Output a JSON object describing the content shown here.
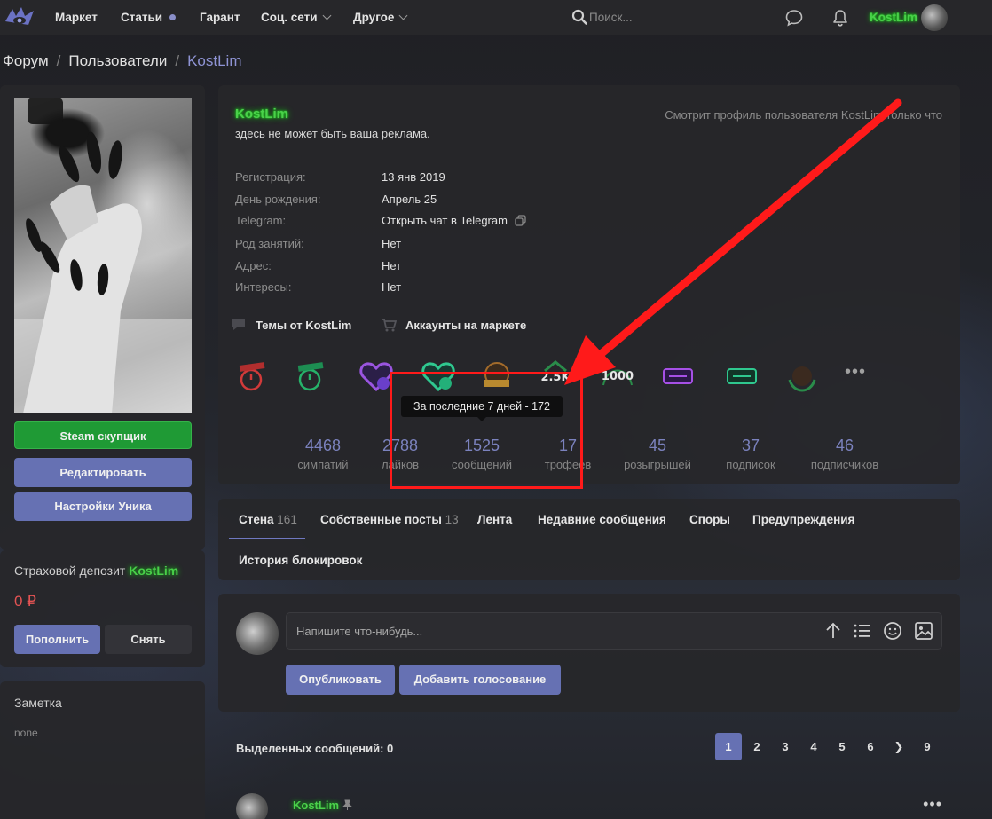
{
  "nav": {
    "items": [
      {
        "label": "Маркет"
      },
      {
        "label": "Статьи"
      },
      {
        "label": "Гарант"
      },
      {
        "label": "Соц. сети"
      },
      {
        "label": "Другое"
      }
    ],
    "search_placeholder": "Поиск...",
    "username": "KostLim"
  },
  "breadcrumb": {
    "items": [
      "Форум",
      "Пользователи",
      "KostLim"
    ]
  },
  "sidebar": {
    "buttons": {
      "steam": "Steam скупщик",
      "edit": "Редактировать",
      "settings": "Настройки Уника"
    },
    "deposit": {
      "title": "Страховой депозит",
      "name": "KostLim",
      "amount": "0 ₽",
      "topup": "Пополнить",
      "withdraw": "Снять"
    },
    "note": {
      "title": "Заметка",
      "text": "none"
    }
  },
  "profile": {
    "name": "KostLim",
    "status": "здесь не может быть ваша реклама.",
    "viewing": "Смотрит профиль пользователя KostLim только что",
    "info": [
      {
        "label": "Регистрация:",
        "value": "13 янв 2019"
      },
      {
        "label": "День рождения:",
        "value": "Апрель 25"
      },
      {
        "label": "Telegram:",
        "value": "Открыть чат в Telegram"
      },
      {
        "label": "Род занятий:",
        "value": "Нет"
      },
      {
        "label": "Адрес:",
        "value": "Нет"
      },
      {
        "label": "Интересы:",
        "value": "Нет"
      }
    ],
    "links": {
      "threads": "Темы от KostLim",
      "market": "Аккаунты на маркете"
    },
    "trophy_icons": [
      "stopwatch-red-icon",
      "stopwatch-green-icon",
      "heart-2500-icon",
      "heart-1000-icon",
      "crown-badge-icon",
      "2-5k-icon",
      "1000-icon",
      "ticket-purple-icon",
      "ticket-green-icon",
      "wreath-badge-icon"
    ],
    "stats": [
      {
        "value": "4468",
        "label": "симпатий"
      },
      {
        "value": "2788",
        "label": "лайков"
      },
      {
        "value": "1525",
        "label": "сообщений"
      },
      {
        "value": "17",
        "label": "трофеев"
      },
      {
        "value": "45",
        "label": "розыгрышей"
      },
      {
        "value": "37",
        "label": "подписок"
      },
      {
        "value": "46",
        "label": "подписчиков"
      }
    ],
    "tooltip": "За последние 7 дней - 172"
  },
  "tabs": [
    {
      "label": "Стена",
      "count": "161"
    },
    {
      "label": "Собственные посты",
      "count": "13"
    },
    {
      "label": "Лента",
      "count": ""
    },
    {
      "label": "Недавние сообщения",
      "count": ""
    },
    {
      "label": "Споры",
      "count": ""
    },
    {
      "label": "Предупреждения",
      "count": ""
    },
    {
      "label": "История блокировок",
      "count": ""
    }
  ],
  "compose": {
    "placeholder": "Напишите что-нибудь...",
    "publish": "Опубликовать",
    "add_poll": "Добавить голосование"
  },
  "pager": {
    "selected": "Выделенных сообщений: 0",
    "pages": [
      "1",
      "2",
      "3",
      "4",
      "5",
      "6",
      "❯",
      "9"
    ]
  },
  "post": {
    "author": "KostLim",
    "more": "•••"
  },
  "colors": {
    "accent": "#6671b3",
    "username_green": "#49d049",
    "annotation_red": "#ff1a1a",
    "deposit_red": "#e35353"
  }
}
